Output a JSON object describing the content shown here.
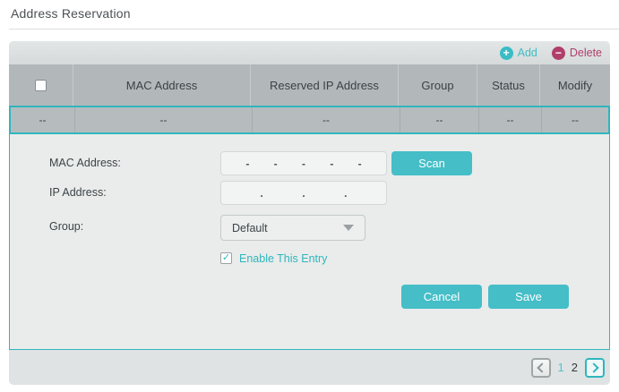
{
  "page": {
    "title": "Address Reservation"
  },
  "toolbar": {
    "add_label": "Add",
    "delete_label": "Delete"
  },
  "icons": {
    "add_glyph": "+",
    "delete_glyph": "−",
    "check_glyph": "✓"
  },
  "table": {
    "headers": [
      "MAC Address",
      "Reserved IP Address",
      "Group",
      "Status",
      "Modify"
    ],
    "row": {
      "cells": [
        "--",
        "--",
        "--",
        "--",
        "--",
        "--"
      ],
      "selected": true
    }
  },
  "form": {
    "mac_label": "MAC Address:",
    "mac_value": "",
    "mac_separators": [
      "-",
      "-",
      "-",
      "-",
      "-"
    ],
    "scan_label": "Scan",
    "ip_label": "IP Address:",
    "ip_value": "",
    "ip_separators": [
      ".",
      ".",
      "."
    ],
    "group_label": "Group:",
    "group_value": "Default",
    "enable_label": "Enable This Entry",
    "enable_checked": true,
    "cancel_label": "Cancel",
    "save_label": "Save"
  },
  "pagination": {
    "pages": [
      {
        "label": "1",
        "current": false
      },
      {
        "label": "2",
        "current": true
      }
    ]
  },
  "colors": {
    "accent_teal": "#2fb6be",
    "button_teal": "#45bec7",
    "delete_pink": "#b03e6b",
    "header_gray": "#b2b8ba",
    "row_gray": "#b6bcbe",
    "panel_gray": "#e9eceb",
    "footer_gray": "#dfe3e3"
  }
}
